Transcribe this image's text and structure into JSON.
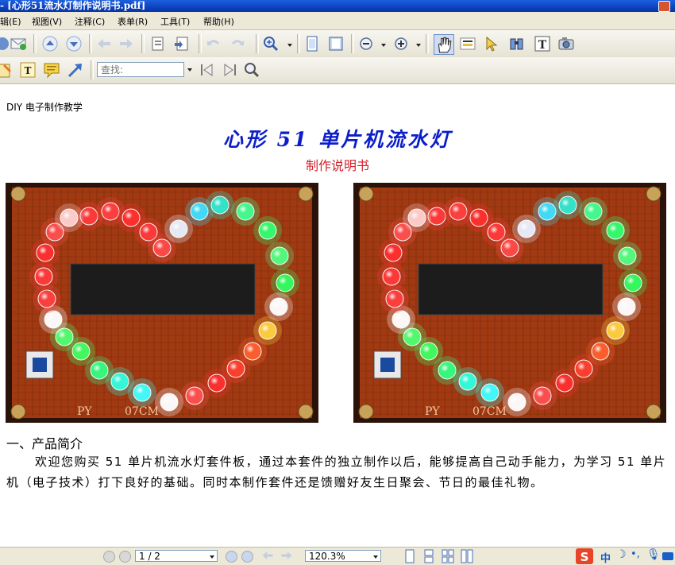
{
  "window": {
    "title": "- [心形51流水灯制作说明书.pdf]"
  },
  "menu": {
    "items": [
      "辑(E)",
      "视图(V)",
      "注释(C)",
      "表单(R)",
      "工具(T)",
      "帮助(H)"
    ]
  },
  "toolbar": {
    "search_placeholder": "查找:"
  },
  "document": {
    "header": "DIY 电子制作教学",
    "title": "心形 51 单片机流水灯",
    "subtitle": "制作说明书",
    "photos": [
      {
        "board_label_left": "PY",
        "board_label_right": "07CM"
      },
      {
        "board_label_left": "PY",
        "board_label_right": "07CM"
      }
    ],
    "section1_heading": "一、产品简介",
    "section1_text": "欢迎您购买 51 单片机流水灯套件板，通过本套件的独立制作以后，能够提高自己动手能力，为学习 51 单片机（电子技术）打下良好的基础。同时本制作套件还是馈赠好友生日聚会、节日的最佳礼物。"
  },
  "statusbar": {
    "page_value": "1 / 2",
    "zoom_value": "120.3%",
    "ime_label": "中"
  },
  "colors": {
    "title_blue": "#0b1ec9",
    "subtitle_red": "#d6202a",
    "board": "#a13a12",
    "titlebar": "#0b3fb8"
  }
}
